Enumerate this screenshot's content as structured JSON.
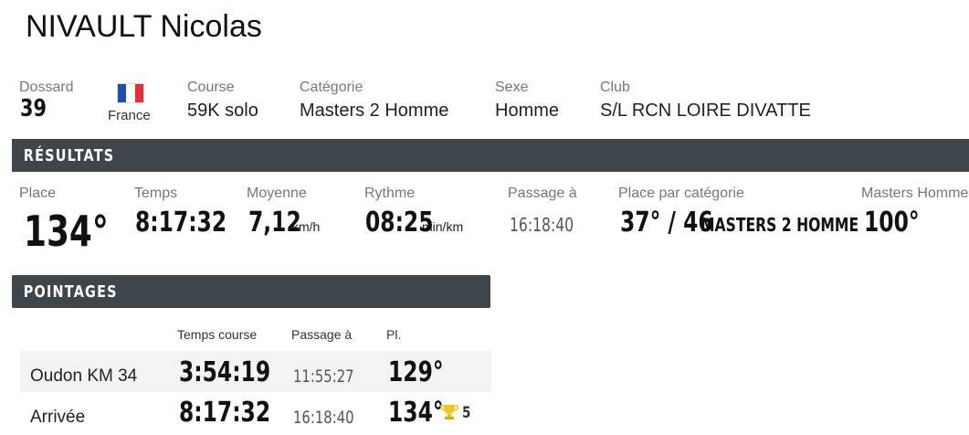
{
  "athlete": {
    "name": "NIVAULT Nicolas"
  },
  "info": {
    "bib_label": "Dossard",
    "bib_value": "39",
    "country": "France",
    "course_label": "Course",
    "course_value": "59K solo",
    "category_label": "Catégorie",
    "category_value": "Masters 2 Homme",
    "sex_label": "Sexe",
    "sex_value": "Homme",
    "club_label": "Club",
    "club_value": "S/L RCN LOIRE DIVATTE"
  },
  "results": {
    "title": "RÉSULTATS",
    "place_label": "Place",
    "place_value": "134°",
    "time_label": "Temps",
    "time_value": "8:17:32",
    "avg_label": "Moyenne",
    "avg_value": "7,12",
    "avg_unit": "km/h",
    "pace_label": "Rythme",
    "pace_value": "08:25",
    "pace_unit": "min/km",
    "passage_label": "Passage à",
    "passage_value": "16:18:40",
    "cat_place_label": "Place par catégorie",
    "cat_place_value": "37° / 46",
    "cat_place_cat": "MASTERS 2 HOMME",
    "masters_label": "Masters Homme",
    "masters_value": "100°"
  },
  "checkpoints": {
    "title": "POINTAGES",
    "col_time": "Temps course",
    "col_passage": "Passage à",
    "col_place": "Pl.",
    "rows": [
      {
        "name": "Oudon KM 34",
        "time": "3:54:19",
        "passage": "11:55:27",
        "place": "129°"
      },
      {
        "name": "Arrivée",
        "time": "8:17:32",
        "passage": "16:18:40",
        "place": "134°",
        "gain": "5"
      }
    ]
  },
  "colors": {
    "band": "#3e464c",
    "flag_blue": "#1f4fb0",
    "flag_red": "#e0313a",
    "trophy": "#f5c518"
  },
  "icons": {
    "flag": "france-flag-icon",
    "trophy": "trophy-icon"
  }
}
